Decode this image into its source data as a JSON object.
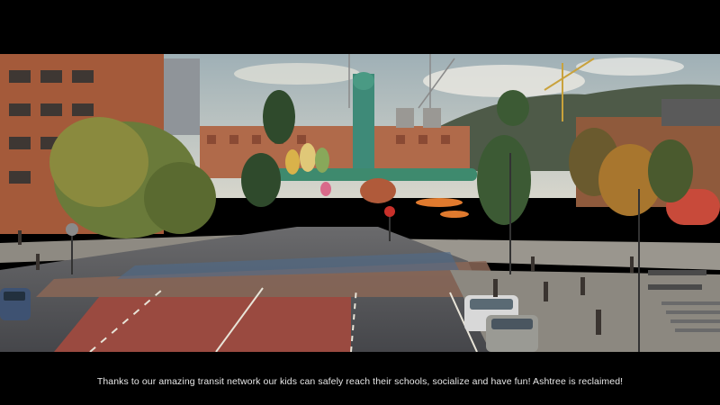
{
  "subtitle": {
    "text": "Thanks to our amazing transit network our kids can safely reach their schools, socialize and have fun! Ashtree is reclaimed!"
  },
  "colors": {
    "sky": "#b9c4c6",
    "brick": "#a45a3a",
    "road": "#4a4c50",
    "painted_plaza": "#8a5a4c",
    "tree_autumn": "#b07a3a",
    "tree_green": "#5a6a30",
    "letterbox": "#000000",
    "subtitle_text": "#e8e8e8"
  }
}
